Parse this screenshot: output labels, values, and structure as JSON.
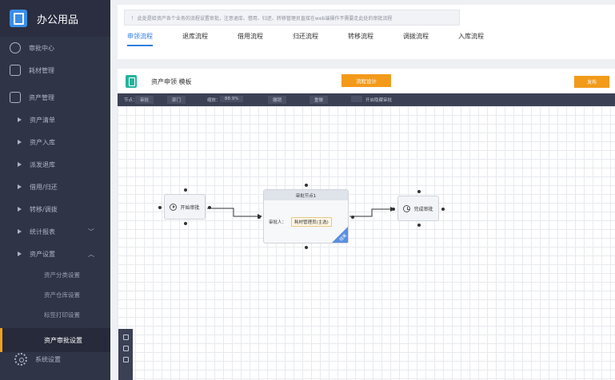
{
  "app": {
    "title": "办公用品"
  },
  "sidebar": {
    "top_items": [
      {
        "label": "审批中心",
        "icon": "user-icon"
      },
      {
        "label": "耗材管理",
        "icon": "cube-icon"
      },
      {
        "label": "资产管理",
        "icon": "folder-icon"
      }
    ],
    "sub_items": [
      {
        "label": "资产清单"
      },
      {
        "label": "资产入库"
      },
      {
        "label": "派发退库"
      },
      {
        "label": "借用/归还"
      },
      {
        "label": "转移/调拨"
      },
      {
        "label": "统计报表",
        "chevron": "﹀"
      },
      {
        "label": "资产设置",
        "chevron": "︿"
      }
    ],
    "leaf_items": [
      {
        "label": "资产分类设置"
      },
      {
        "label": "资产仓库设置"
      },
      {
        "label": "标签打印设置"
      }
    ],
    "active_item": {
      "label": "资产审批设置"
    },
    "bottom_item": {
      "label": "系统设置",
      "icon": "gear-icon"
    }
  },
  "notice": {
    "text": "！ 此处是给资产各个业务的流程设置审批，注意退库、借用、归还、转移管理员直接在web端操作不需要走此处的审批流程"
  },
  "tabs": [
    {
      "label": "申领流程",
      "active": true
    },
    {
      "label": "退库流程"
    },
    {
      "label": "借用流程"
    },
    {
      "label": "归还流程"
    },
    {
      "label": "转移流程"
    },
    {
      "label": "调拨流程"
    },
    {
      "label": "入库流程"
    }
  ],
  "editor": {
    "title": "资产申领 模板",
    "design_button": "流程设计",
    "publish_button": "发布"
  },
  "toolbar": {
    "node_label": "节点：",
    "node_value": "审批",
    "dept": "部门",
    "zoom_label": "缩放：",
    "zoom_value": "88.9%",
    "undo": "撤销",
    "redo": "重做",
    "toggle_label": "开启隐藏审批"
  },
  "flow": {
    "start_node": "开始审批",
    "approval_node": {
      "title": "审批节点1",
      "approver_label": "审批人：",
      "approver_value": "耗材管理员(主选)",
      "corner_tag": "结束"
    },
    "end_node": "完成审批"
  },
  "colors": {
    "sidebar_bg": "#2f3447",
    "accent_blue": "#2f7de1",
    "accent_orange": "#f39a1a",
    "brand_blue": "#3a8ee6",
    "editor_icon": "#25b39e"
  }
}
